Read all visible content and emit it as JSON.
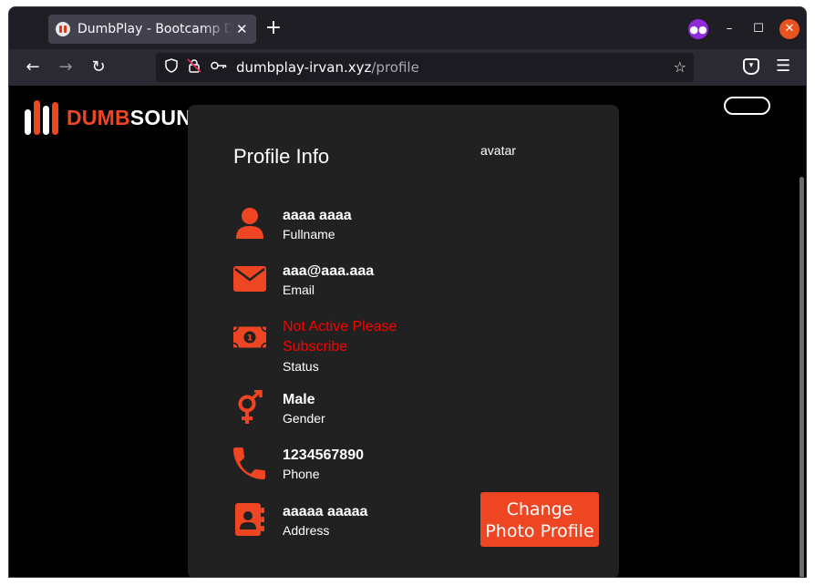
{
  "browser": {
    "tab_title": "DumbPlay - Bootcamp De",
    "tab_close": "✕",
    "new_tab": "+",
    "url_domain": "dumbplay-irvan.xyz",
    "url_path": "/profile",
    "win_min": "–",
    "win_max": "☐",
    "win_close": "✕"
  },
  "brand": {
    "part1": "DUMB",
    "part2": "SOUND"
  },
  "profile": {
    "title": "Profile Info",
    "avatar_alt": "avatar",
    "rows": [
      {
        "value": "aaaa aaaa",
        "label": "Fullname"
      },
      {
        "value": "aaa@aaa.aaa",
        "label": "Email"
      },
      {
        "value": "Not Active Please Subscribe",
        "label": "Status"
      },
      {
        "value": "Male",
        "label": "Gender"
      },
      {
        "value": "1234567890",
        "label": "Phone"
      },
      {
        "value": "aaaaa aaaaa",
        "label": "Address"
      }
    ],
    "change_photo_button": "Change Photo Profile"
  },
  "colors": {
    "accent": "#ee4622",
    "danger": "#ff0000",
    "card": "#212121",
    "background": "#000000"
  },
  "icons": [
    "user-icon",
    "envelope-icon",
    "money-bill-icon",
    "venus-mars-icon",
    "phone-icon",
    "address-book-icon"
  ]
}
